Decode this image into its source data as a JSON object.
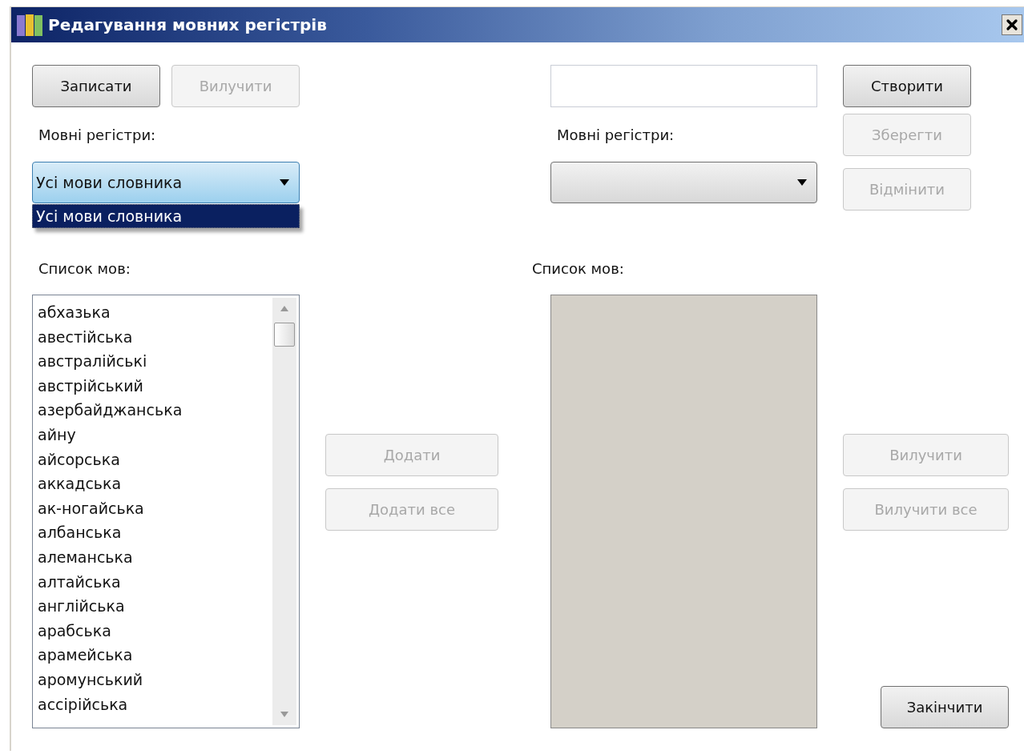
{
  "window": {
    "title": "Редагування мовних регістрів"
  },
  "left": {
    "buttons": [
      {
        "label": "Записати",
        "disabled": false
      },
      {
        "label": "Вилучити",
        "disabled": true
      }
    ],
    "registers_label": "Мовні регістри:",
    "combo": {
      "value": "Усі мови словника",
      "expanded": true,
      "options": [
        {
          "label": "Усі мови словника",
          "selected": true
        }
      ]
    },
    "languages_label": "Список мов:",
    "languages": [
      "абхазька",
      "авестійська",
      "австралійські",
      "австрійський",
      "азербайджанська",
      "айну",
      "айсорська",
      "аккадська",
      "ак-ногайська",
      "албанська",
      "алеманська",
      "алтайська",
      "англійська",
      "арабська",
      "арамейська",
      "аромунський",
      "ассірійська"
    ]
  },
  "middle": {
    "buttons": [
      {
        "label": "Додати",
        "disabled": true
      },
      {
        "label": "Додати все",
        "disabled": true
      }
    ]
  },
  "right": {
    "create_button": {
      "label": "Створити",
      "disabled": false
    },
    "registers_label": "Мовні регістри:",
    "combo": {
      "expanded": false
    },
    "side_buttons": [
      {
        "label": "Зберегти",
        "disabled": true
      },
      {
        "label": "Відмінити",
        "disabled": true
      }
    ],
    "languages_label": "Список мов:",
    "remove_buttons": [
      {
        "label": "Вилучити",
        "disabled": true
      },
      {
        "label": "Вилучити все",
        "disabled": true
      }
    ],
    "finish_button": {
      "label": "Закінчити",
      "disabled": false
    }
  }
}
